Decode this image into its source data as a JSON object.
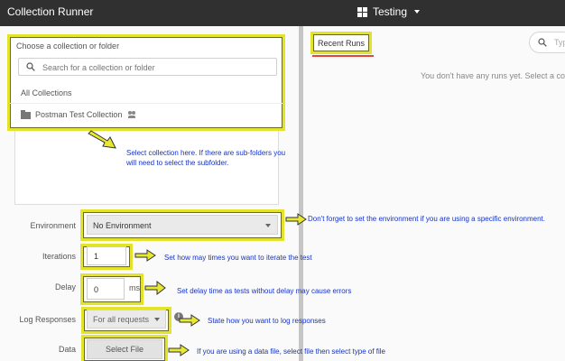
{
  "topbar": {
    "title": "Collection Runner",
    "workspace": "Testing",
    "icons": [
      "grid-icon",
      "caret-down-icon"
    ]
  },
  "collection_picker": {
    "label": "Choose a collection or folder",
    "search_placeholder": "Search for a collection or folder",
    "all_collections": "All Collections",
    "items": [
      {
        "name": "Postman Test Collection",
        "icon": "folder-icon",
        "badge_icon": "team-icon"
      }
    ]
  },
  "form": {
    "environment_label": "Environment",
    "environment_value": "No Environment",
    "iterations_label": "Iterations",
    "iterations_value": "1",
    "delay_label": "Delay",
    "delay_value": "0",
    "delay_unit": "ms",
    "log_label": "Log Responses",
    "log_value": "For all requests",
    "data_label": "Data",
    "data_button": "Select File"
  },
  "annotations": {
    "collection": "Select collection here. If there are sub-folders you will need to select the subfolder.",
    "environment": "Don't forget to set the environment if you are using a specific environment.",
    "iterations": "Set how may times you want to iterate the test",
    "delay": "Set delay time as tests without delay may cause errors",
    "log": "State how you want to log responses",
    "data": "If you are using a data file, select file then select type of file"
  },
  "right_panel": {
    "tab": "Recent Runs",
    "search_placeholder": "Typ",
    "empty_text": "You don't have any runs yet. Select a colle"
  },
  "colors": {
    "topbar": "#303030",
    "highlight": "#e3e32b",
    "annotation_text": "#1533c9",
    "tab_underline": "#e3453a"
  }
}
